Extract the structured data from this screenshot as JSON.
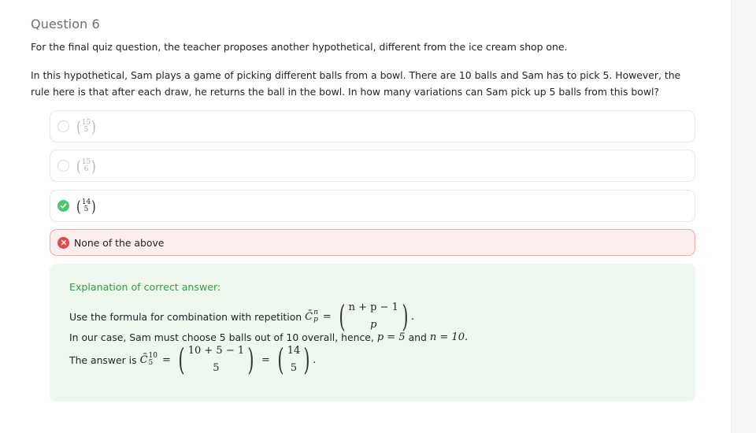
{
  "question": {
    "title": "Question 6",
    "paragraph1": "For the final quiz question, the teacher proposes another hypothetical, different from the ice cream shop one.",
    "paragraph2": "In this hypothetical, Sam plays a game of picking different balls from a bowl. There are 10 balls and Sam has to pick 5. However, the rule here is that after each draw, he returns the ball in the bowl. In how many variations can Sam pick up 5 balls from this bowl?"
  },
  "options": [
    {
      "top": "15",
      "bottom": "5",
      "state": "unselected"
    },
    {
      "top": "15",
      "bottom": "6",
      "state": "unselected"
    },
    {
      "top": "14",
      "bottom": "5",
      "state": "correct"
    },
    {
      "label": "None of the above",
      "state": "wrong"
    }
  ],
  "explanation": {
    "title": "Explanation of correct answer:",
    "line1_prefix": "Use the formula for combination with repetition",
    "formula_top": "n + p − 1",
    "formula_bottom": "p",
    "line2_prefix": "In our case, Sam must choose 5 balls out of 10 overall, hence,",
    "p_eq": "p = 5",
    "and": "and",
    "n_eq": "n = 10.",
    "line3_prefix": "The answer is",
    "answer_top": "10 + 5 − 1",
    "answer_bottom": "5",
    "final_top": "14",
    "final_bottom": "5"
  },
  "colors": {
    "correct": "#4cc76e",
    "wrong": "#e5484d",
    "wrong_bg": "#fdeeee",
    "explanation_bg": "#eef7ee",
    "explanation_title": "#2f9e44"
  },
  "icons": {
    "correct": "check-circle-icon",
    "wrong": "x-circle-icon"
  }
}
